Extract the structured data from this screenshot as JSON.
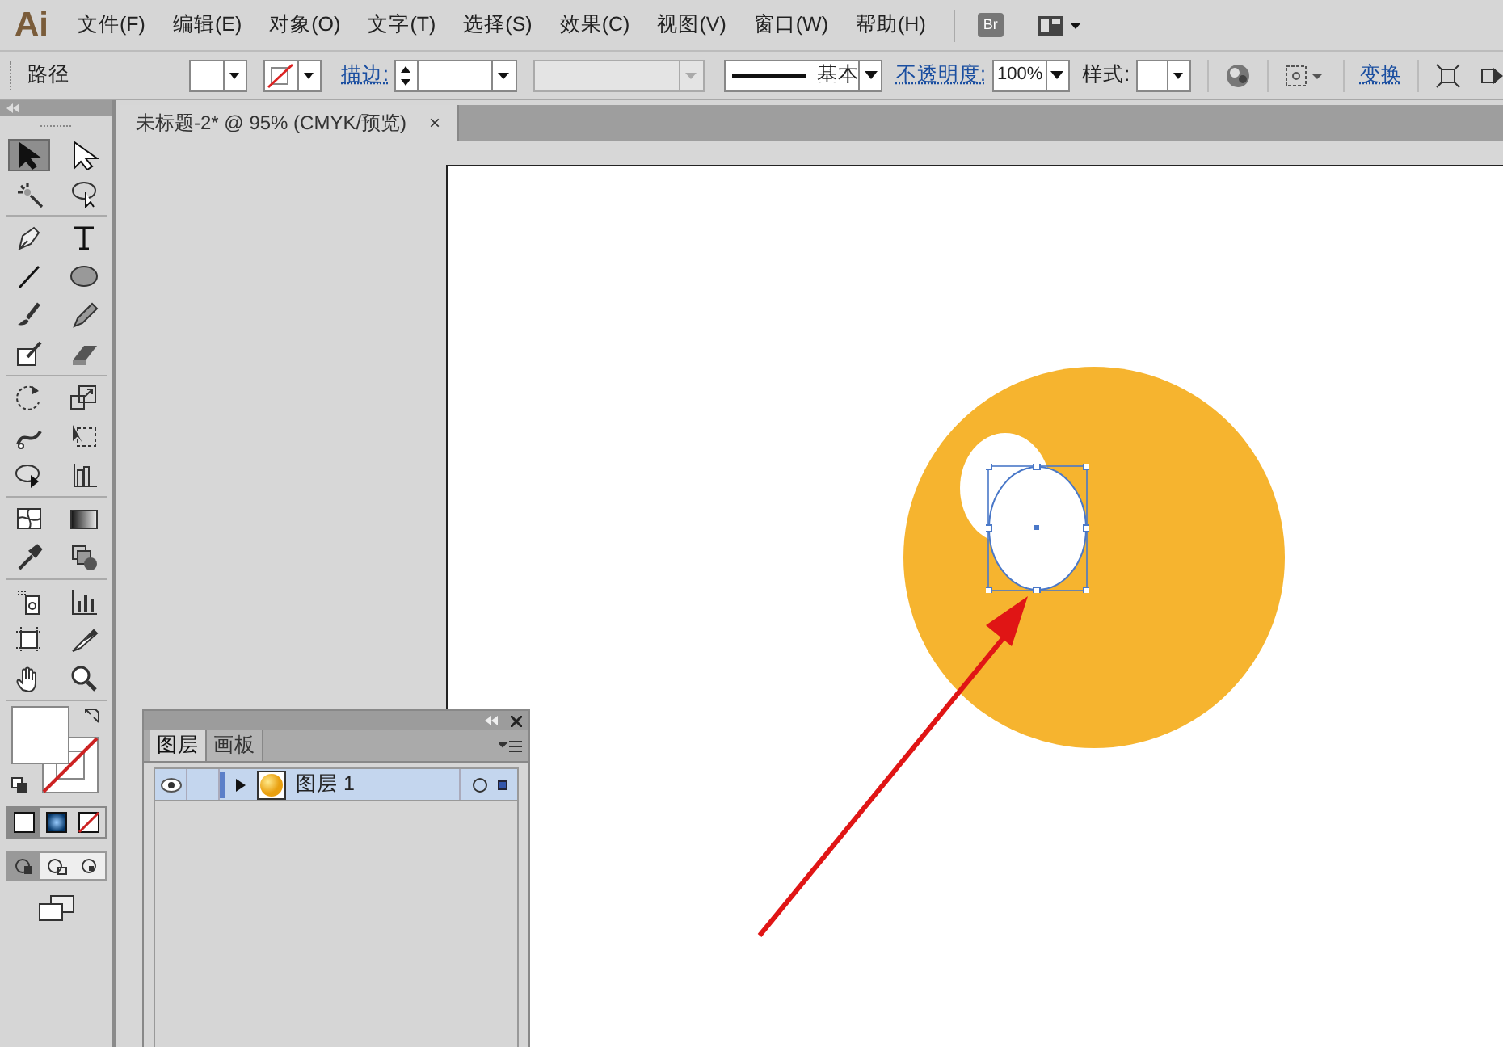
{
  "app": {
    "logo": "Ai",
    "menus": [
      "文件(F)",
      "编辑(E)",
      "对象(O)",
      "文字(T)",
      "选择(S)",
      "效果(C)",
      "视图(V)",
      "窗口(W)",
      "帮助(H)"
    ],
    "bridge_button": "Br"
  },
  "control_bar": {
    "selection_label": "路径",
    "stroke_label": "描边:",
    "stroke_profile": "基本",
    "opacity_label": "不透明度:",
    "opacity_value": "100%",
    "style_label": "样式:",
    "transform_link": "变换"
  },
  "tools": [
    {
      "selected": true
    },
    {
      "selected": false
    },
    {
      "selected": false
    },
    {
      "selected": false
    },
    {
      "selected": false
    },
    {
      "selected": false
    },
    {
      "selected": false
    },
    {
      "selected": false
    },
    {
      "selected": false
    },
    {
      "selected": false
    },
    {
      "selected": false
    },
    {
      "selected": false
    },
    {
      "selected": false
    },
    {
      "selected": false
    },
    {
      "selected": false
    },
    {
      "selected": false
    },
    {
      "selected": false
    },
    {
      "selected": false
    },
    {
      "selected": false
    },
    {
      "selected": false
    },
    {
      "selected": false
    },
    {
      "selected": false
    },
    {
      "selected": false
    },
    {
      "selected": false
    },
    {
      "selected": false
    },
    {
      "selected": false
    },
    {
      "selected": false
    },
    {
      "selected": false
    }
  ],
  "document_tab": {
    "title": "未标题-2* @ 95% (CMYK/预览)",
    "close": "×"
  },
  "layers_panel": {
    "tabs": [
      {
        "label": "图层",
        "selected": true
      },
      {
        "label": "画板",
        "selected": false
      }
    ],
    "layers": [
      {
        "name": "图层 1",
        "visible": true,
        "expanded": false,
        "selected": true
      }
    ]
  }
}
